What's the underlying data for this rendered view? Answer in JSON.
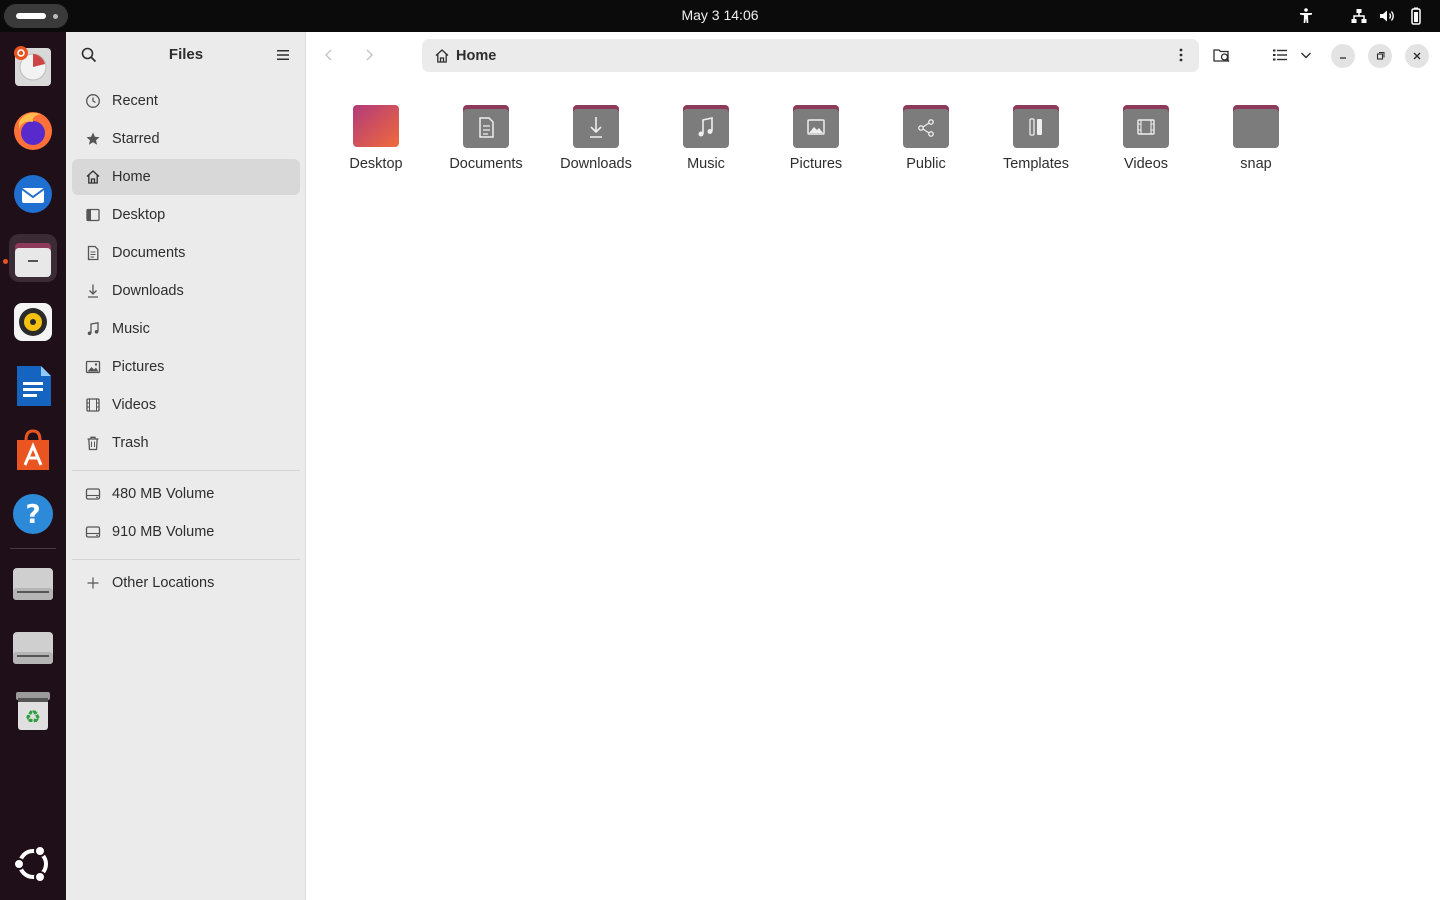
{
  "topbar": {
    "datetime": "May 3  14:06"
  },
  "dock": {
    "items": [
      {
        "name": "disk-usage-analyzer"
      },
      {
        "name": "firefox"
      },
      {
        "name": "thunderbird"
      },
      {
        "name": "files"
      },
      {
        "name": "rhythmbox"
      },
      {
        "name": "libreoffice-writer"
      },
      {
        "name": "app-center"
      },
      {
        "name": "help"
      },
      {
        "name": "drive-480mb"
      },
      {
        "name": "drive-910mb"
      },
      {
        "name": "trash"
      },
      {
        "name": "show-apps"
      }
    ]
  },
  "sidebar": {
    "title": "Files",
    "places": [
      {
        "label": "Recent",
        "icon": "clock-icon"
      },
      {
        "label": "Starred",
        "icon": "star-icon"
      },
      {
        "label": "Home",
        "icon": "home-icon",
        "selected": true
      },
      {
        "label": "Desktop",
        "icon": "desktop-icon"
      },
      {
        "label": "Documents",
        "icon": "document-icon"
      },
      {
        "label": "Downloads",
        "icon": "download-icon"
      },
      {
        "label": "Music",
        "icon": "music-icon"
      },
      {
        "label": "Pictures",
        "icon": "picture-icon"
      },
      {
        "label": "Videos",
        "icon": "video-icon"
      },
      {
        "label": "Trash",
        "icon": "trash-icon"
      }
    ],
    "volumes": [
      {
        "label": "480 MB Volume",
        "icon": "drive-icon"
      },
      {
        "label": "910 MB Volume",
        "icon": "drive-icon"
      }
    ],
    "other": {
      "label": "Other Locations",
      "icon": "plus-icon"
    }
  },
  "path": {
    "current": "Home"
  },
  "folders": [
    {
      "label": "Desktop",
      "icon": "desktop-folder"
    },
    {
      "label": "Documents",
      "icon": "document-icon"
    },
    {
      "label": "Downloads",
      "icon": "download-icon"
    },
    {
      "label": "Music",
      "icon": "music-icon"
    },
    {
      "label": "Pictures",
      "icon": "picture-icon"
    },
    {
      "label": "Public",
      "icon": "share-icon"
    },
    {
      "label": "Templates",
      "icon": "template-icon"
    },
    {
      "label": "Videos",
      "icon": "video-icon"
    },
    {
      "label": "snap",
      "icon": "plain-folder"
    }
  ],
  "colors": {
    "accent": "#e95420",
    "folder_top": "#8e3a5a",
    "folder_body": "#7a7a7a",
    "dock_bg": "#1e0f18"
  }
}
